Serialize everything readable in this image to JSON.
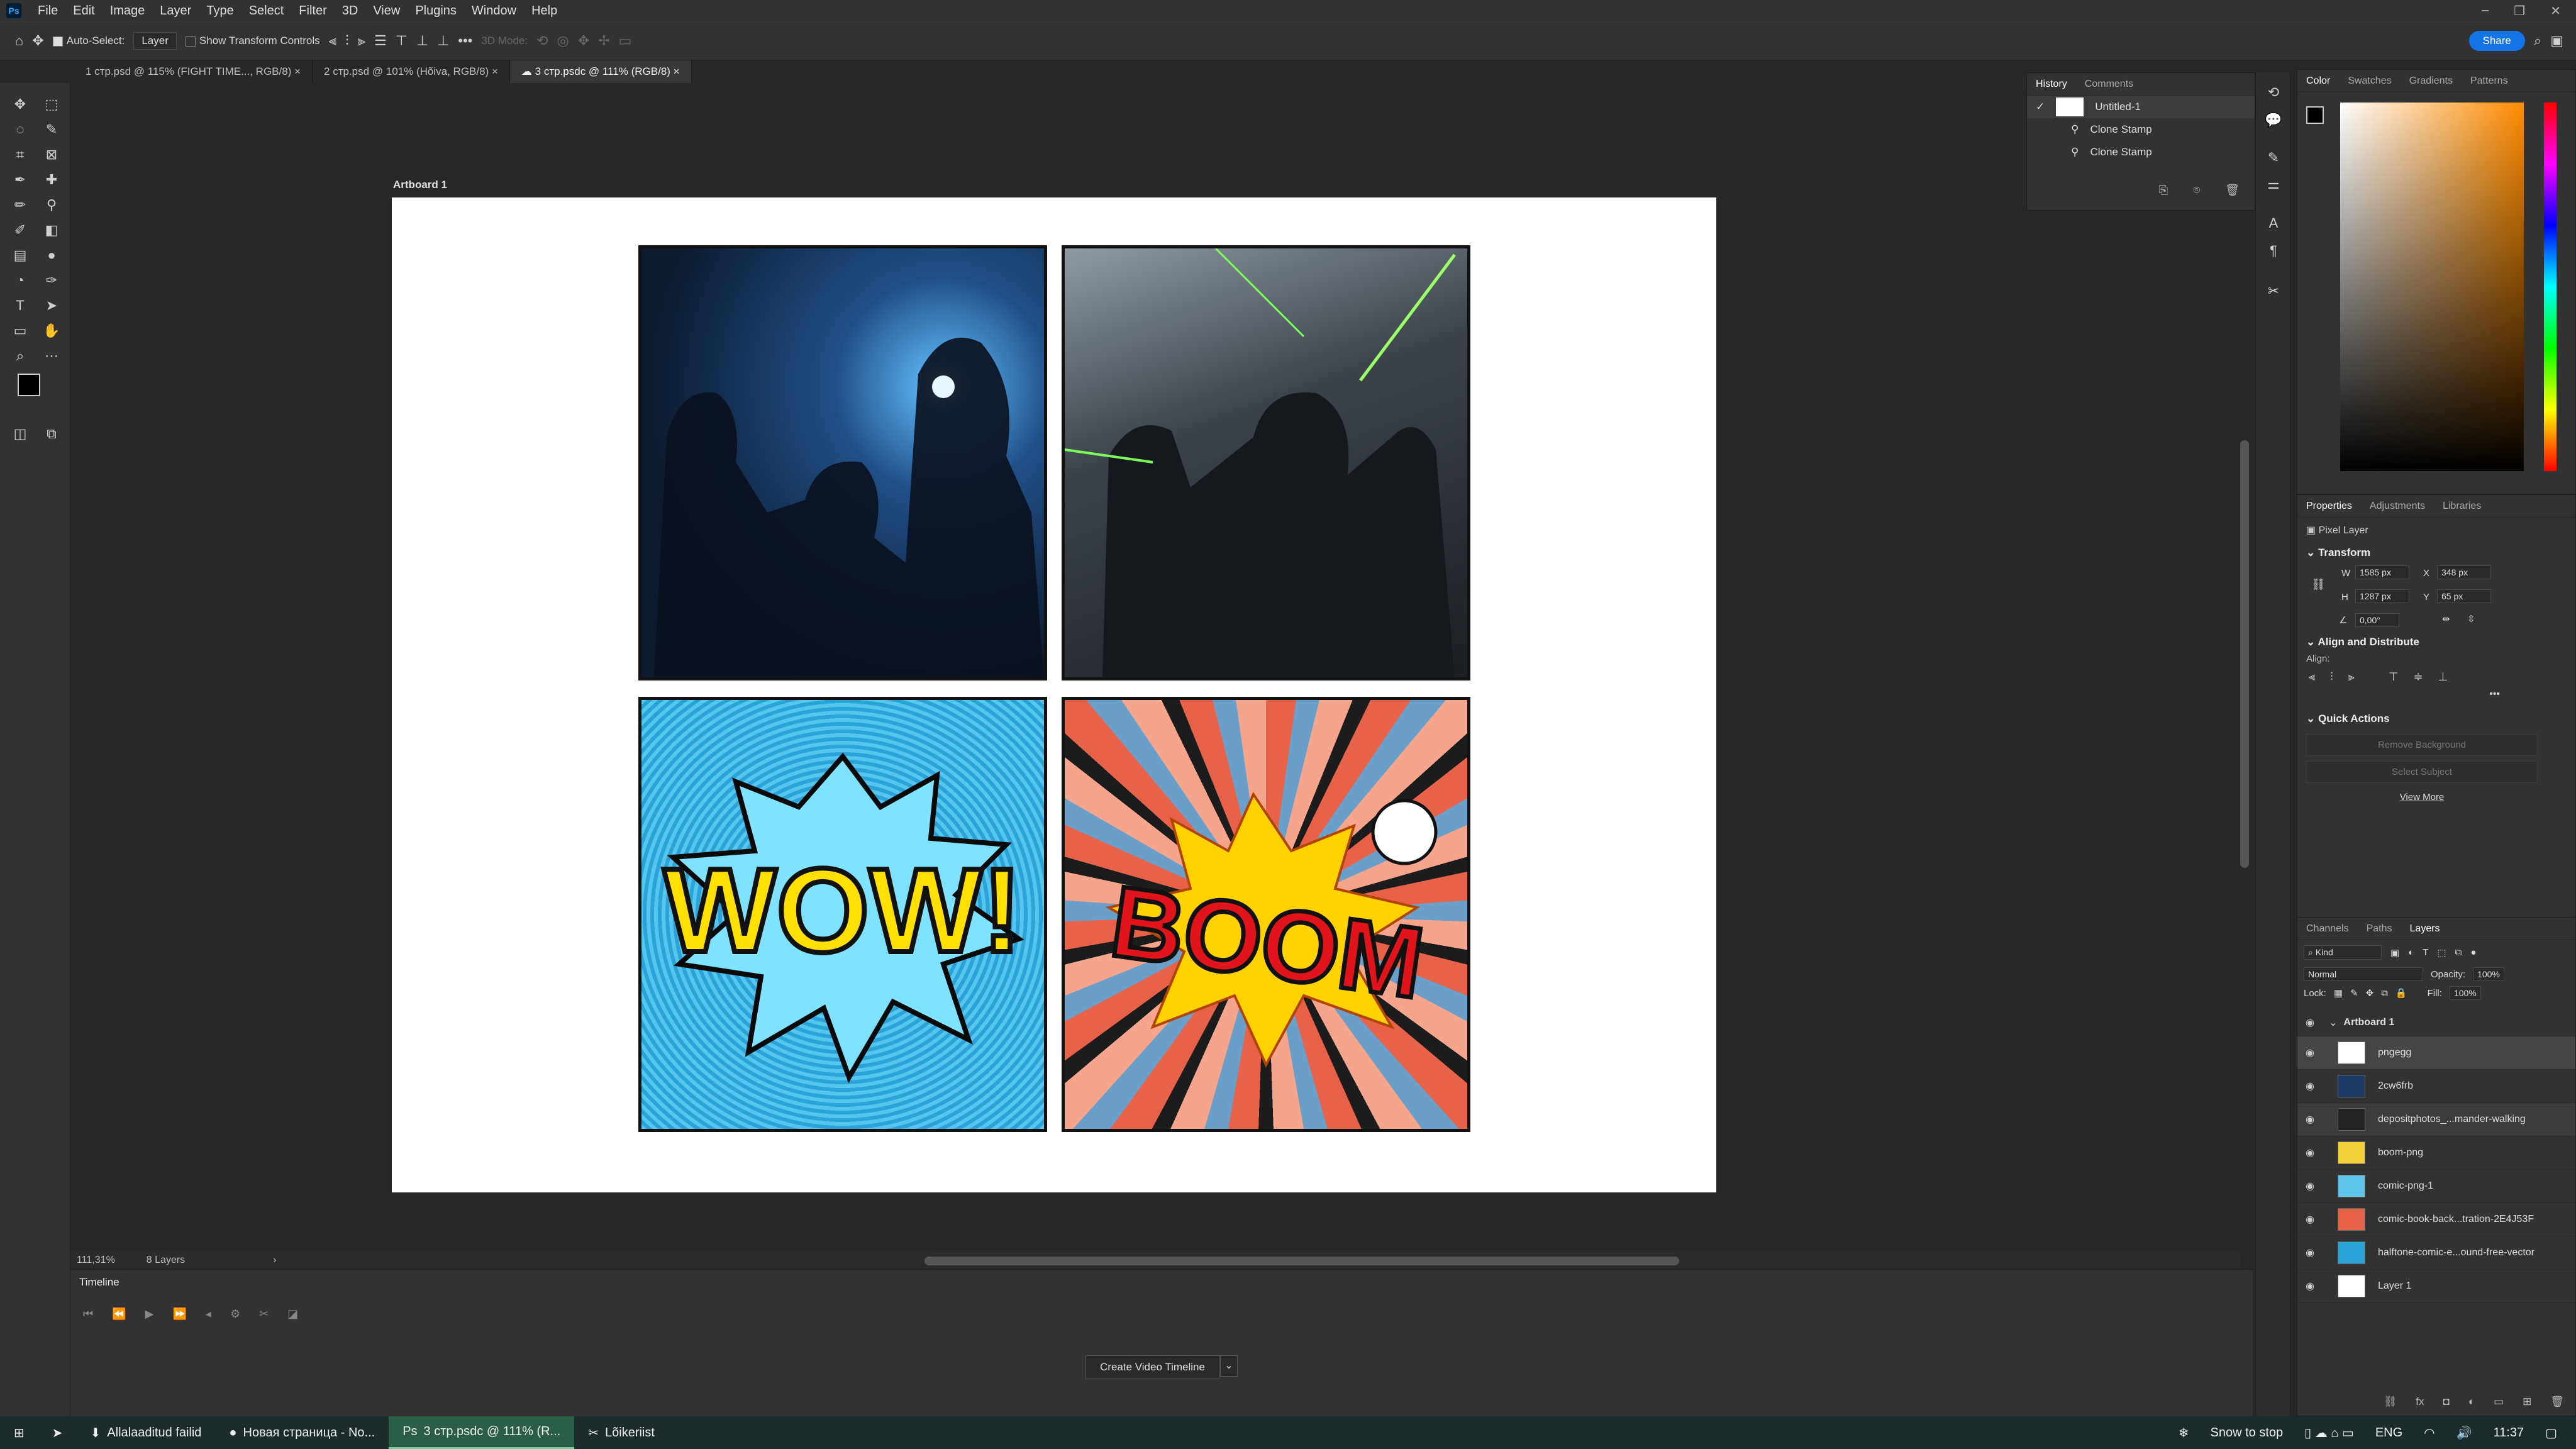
{
  "menubar": {
    "logo": "Ps",
    "items": [
      "File",
      "Edit",
      "Image",
      "Layer",
      "Type",
      "Select",
      "Filter",
      "3D",
      "View",
      "Plugins",
      "Window",
      "Help"
    ],
    "win_controls": [
      "–",
      "❐",
      "✕"
    ]
  },
  "options": {
    "auto_select_label": "Auto-Select:",
    "auto_select_value": "Layer",
    "show_transform_label": "Show Transform Controls",
    "more": "•••",
    "mode_3d": "3D Mode:",
    "share_label": "Share"
  },
  "tabs": [
    {
      "label": "1 стр.psd @ 115% (FIGHT TIME..., RGB/8)",
      "close": "×"
    },
    {
      "label": "2 стр.psd @ 101% (Hõiva, RGB/8)",
      "close": "×"
    },
    {
      "label": "3 стр.psdc @ 111% (RGB/8)",
      "close": "×"
    }
  ],
  "canvas": {
    "artboard_label": "Artboard 1",
    "wow_text": "WOW!",
    "boom_text": "BOOM"
  },
  "status": {
    "zoom": "111,31%",
    "layers": "8 Layers",
    "arrow": "›"
  },
  "timeline": {
    "title": "Timeline",
    "create_button": "Create Video Timeline"
  },
  "history_panel": {
    "tabs": [
      "History",
      "Comments"
    ],
    "rows": [
      {
        "label": "Untitled-1"
      },
      {
        "label": "Clone Stamp"
      },
      {
        "label": "Clone Stamp"
      }
    ]
  },
  "color_panel": {
    "tabs": [
      "Color",
      "Swatches",
      "Gradients",
      "Patterns"
    ],
    "accent": "#ff8c00"
  },
  "properties_panel": {
    "tabs": [
      "Properties",
      "Adjustments",
      "Libraries"
    ],
    "layer_type": "Pixel Layer",
    "transform_title": "Transform",
    "w_label": "W",
    "w_value": "1585 px",
    "h_label": "H",
    "h_value": "1287 px",
    "x_label": "X",
    "x_value": "348 px",
    "y_label": "Y",
    "y_value": "65 px",
    "angle_value": "0,00°",
    "align_title": "Align and Distribute",
    "align_label": "Align:",
    "more": "•••",
    "quick_title": "Quick Actions",
    "remove_bg": "Remove Background",
    "select_subject": "Select Subject",
    "view_more": "View More"
  },
  "layers_panel": {
    "tabs": [
      "Channels",
      "Paths",
      "Layers"
    ],
    "kind": "Kind",
    "blend": "Normal",
    "opacity_label": "Opacity:",
    "opacity_value": "100%",
    "lock_label": "Lock:",
    "fill_label": "Fill:",
    "fill_value": "100%",
    "group": "Artboard 1",
    "layers": [
      {
        "name": "pngegg"
      },
      {
        "name": "2cw6frb"
      },
      {
        "name": "depositphotos_...mander-walking"
      },
      {
        "name": "boom-png"
      },
      {
        "name": "comic-png-1"
      },
      {
        "name": "comic-book-back...tration-2E4J53F"
      },
      {
        "name": "halftone-comic-e...ound-free-vector"
      },
      {
        "name": "Layer 1"
      }
    ]
  },
  "taskbar": {
    "items": [
      {
        "label": "Allalaaditud failid"
      },
      {
        "label": "Новая страница - No..."
      },
      {
        "label": "3 стр.psdc @ 111% (R..."
      },
      {
        "label": "Lõikeriist"
      }
    ],
    "snow": "Snow to stop",
    "lang": "ENG",
    "time": "11:37"
  }
}
